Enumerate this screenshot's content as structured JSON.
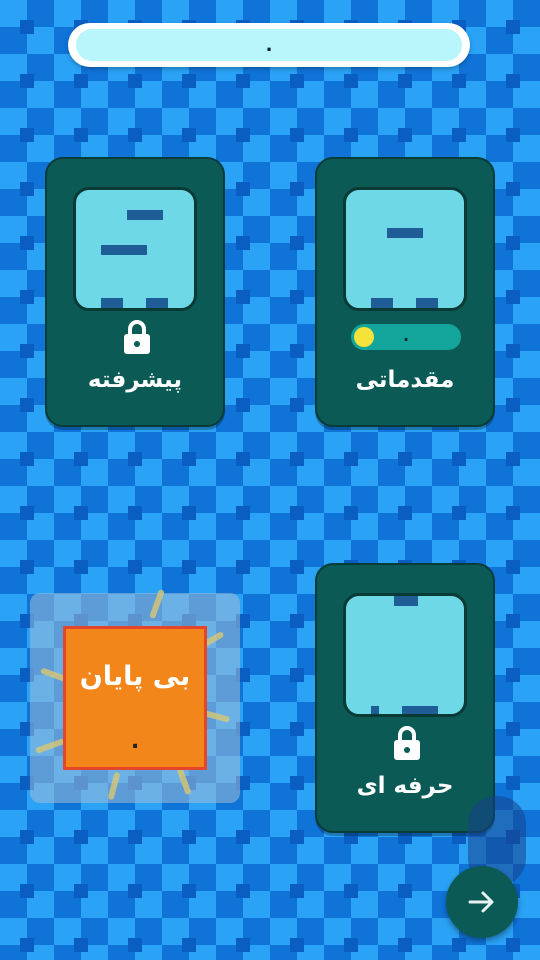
{
  "header": {
    "value": "."
  },
  "modes": {
    "beginner": {
      "label": "مقدماتی",
      "progress_text": ".",
      "locked": false
    },
    "advanced": {
      "label": "پیشرفته",
      "locked": true
    },
    "professional": {
      "label": "حرفه ای",
      "locked": true
    },
    "endless": {
      "label": "بی پایان",
      "score": "."
    }
  },
  "icons": {
    "lock": "lock-icon",
    "next": "arrow-right-icon"
  },
  "colors": {
    "card": "#0b5a55",
    "screen": "#6fd8e7",
    "endless": "#f2861b",
    "background_light": "#2aa2f5",
    "background_dark": "#0f73d8"
  }
}
